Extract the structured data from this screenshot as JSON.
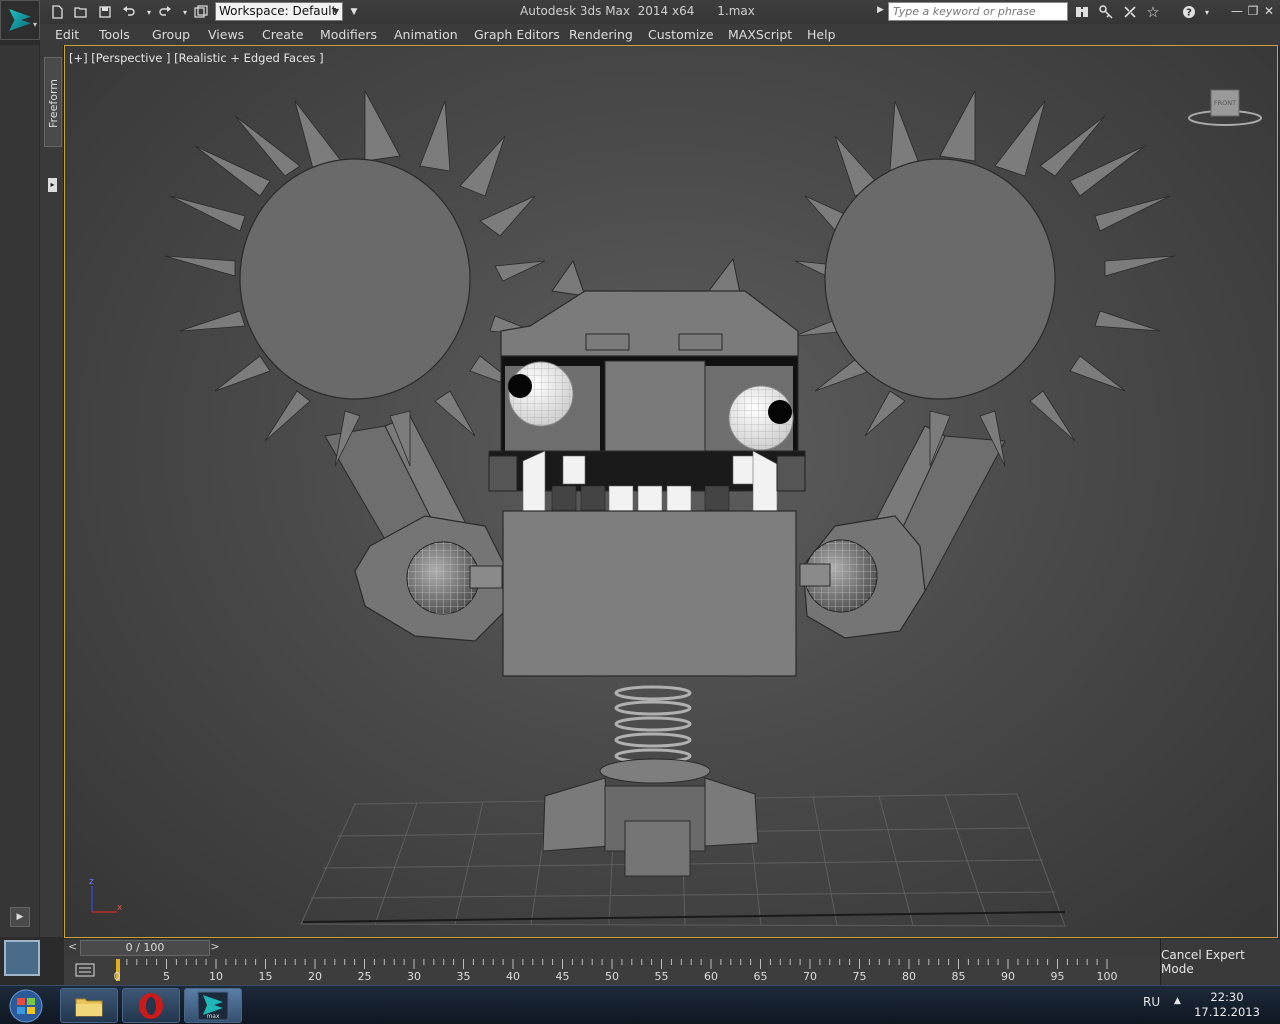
{
  "title_bar": {
    "window_title": "Autodesk 3ds Max  2014 x64      1.max",
    "workspace_label": "Workspace: Default",
    "search_placeholder": "Type a keyword or phrase",
    "quick_access_icons": [
      "new-file-icon",
      "open-folder-icon",
      "save-icon",
      "undo-icon",
      "redo-icon",
      "project-folder-icon"
    ],
    "info_icons": [
      "binoculars-icon",
      "key-icon",
      "tools-icon",
      "star-icon",
      "help-icon"
    ]
  },
  "menu": {
    "items": [
      "Edit",
      "Tools",
      "Group",
      "Views",
      "Create",
      "Modifiers",
      "Animation",
      "Graph Editors",
      "Rendering",
      "Customize",
      "MAXScript",
      "Help"
    ]
  },
  "left_panel": {
    "tab_label": "Freeform"
  },
  "viewport": {
    "label": "[+] [Perspective ] [Realistic + Edged Faces ]",
    "viewcube_face": "FRONT",
    "axis_z": "z",
    "axis_x": "x"
  },
  "timeline": {
    "slider_value": "0 / 100",
    "prev": "<",
    "next": ">",
    "ticks": [
      "0",
      "5",
      "10",
      "15",
      "20",
      "25",
      "30",
      "35",
      "40",
      "45",
      "50",
      "55",
      "60",
      "65",
      "70",
      "75",
      "80",
      "85",
      "90",
      "95",
      "100"
    ]
  },
  "status": {
    "cancel_expert": "Cancel Expert Mode"
  },
  "taskbar": {
    "lang": "RU",
    "time": "22:30",
    "date": "17.12.2013",
    "app_label": "max",
    "accent_colors": {
      "max_teal": "#1fb6b8",
      "opera_red": "#cc1a1a",
      "folder_yellow": "#e8c45a"
    }
  }
}
